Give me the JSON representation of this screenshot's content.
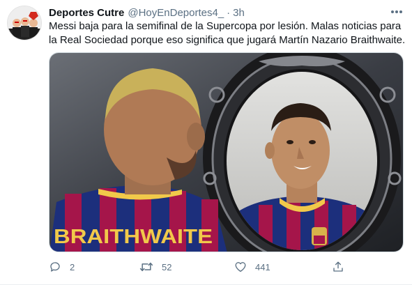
{
  "tweet": {
    "author_name": "Deportes Cutre",
    "author_handle": "@HoyEnDeportes4_",
    "separator": "·",
    "time": "3h",
    "text": "Messi baja para la semifinal de la Supercopa por lesión. Malas noticias para la Real Sociedad porque eso significa que jugará Martín Nazario Braithwaite.",
    "image": {
      "jersey_text": "BRAITHWAITE"
    },
    "actions": {
      "reply_count": "2",
      "retweet_count": "52",
      "like_count": "441"
    }
  },
  "icons": {
    "more": "more-horizontal-icon",
    "reply": "reply-icon",
    "retweet": "retweet-icon",
    "like": "heart-icon",
    "share": "share-icon"
  },
  "colors": {
    "text": "#0f1419",
    "secondary": "#5b7083",
    "border": "#cfd9de",
    "barca_blue": "#1c2f7c",
    "barca_red": "#a5154a",
    "gold": "#f1c94a"
  }
}
